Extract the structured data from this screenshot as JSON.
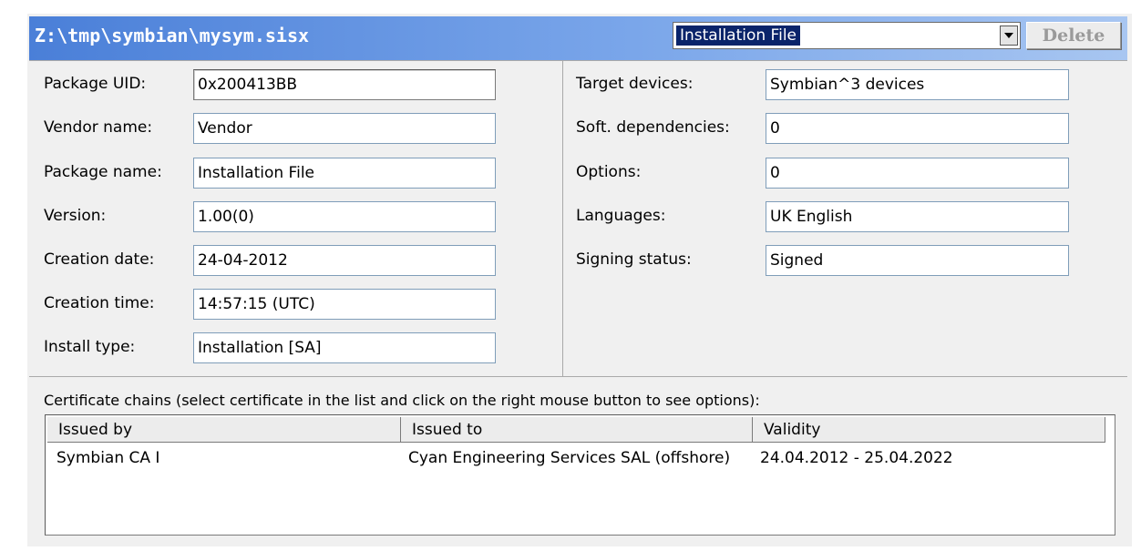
{
  "window": {
    "title": "Z:\\tmp\\symbian\\mysym.sisx",
    "combo_selected": "Installation File",
    "delete_label": "Delete"
  },
  "left_fields": [
    {
      "label": "Package UID:",
      "value": "0x200413BB"
    },
    {
      "label": "Vendor name:",
      "value": "Vendor"
    },
    {
      "label": "Package name:",
      "value": "Installation File"
    },
    {
      "label": "Version:",
      "value": "1.00(0)"
    },
    {
      "label": "Creation date:",
      "value": "24-04-2012"
    },
    {
      "label": "Creation time:",
      "value": "14:57:15 (UTC)"
    },
    {
      "label": "Install type:",
      "value": "Installation [SA]"
    }
  ],
  "right_fields": [
    {
      "label": "Target devices:",
      "value": "Symbian^3 devices"
    },
    {
      "label": "Soft. dependencies:",
      "value": "0"
    },
    {
      "label": "Options:",
      "value": "0"
    },
    {
      "label": "Languages:",
      "value": "UK English"
    },
    {
      "label": "Signing status:",
      "value": "Signed"
    }
  ],
  "certificates": {
    "caption": "Certificate chains (select certificate in the list and click on the right mouse button to see options):",
    "columns": [
      "Issued by",
      "Issued to",
      "Validity"
    ],
    "rows": [
      [
        "Symbian CA I",
        "Cyan Engineering Services SAL (offshore)",
        "24.04.2012 - 25.04.2022"
      ]
    ]
  }
}
